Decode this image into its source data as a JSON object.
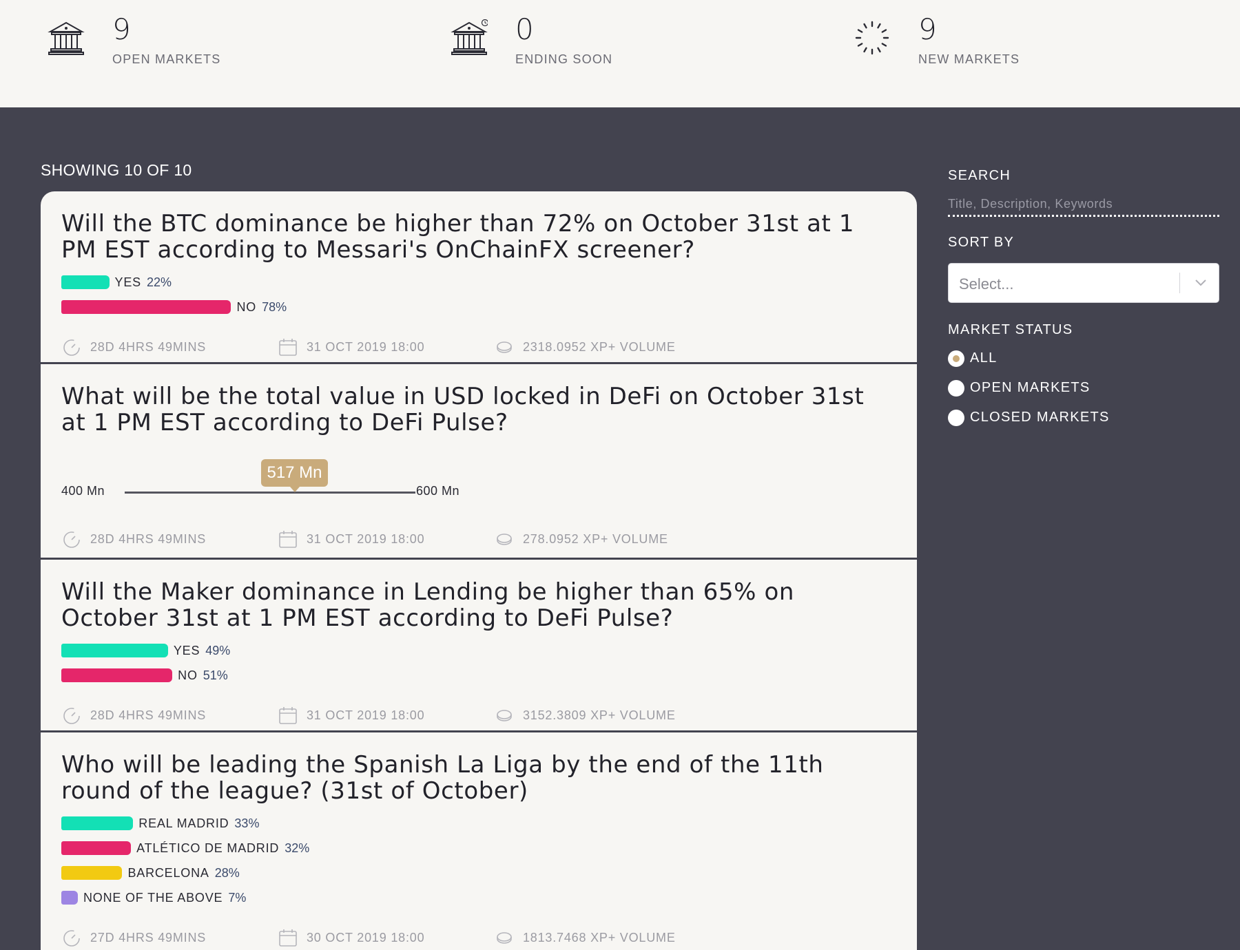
{
  "stats": [
    {
      "value": "9",
      "label": "OPEN MARKETS",
      "icon": "bank-icon"
    },
    {
      "value": "0",
      "label": "ENDING SOON",
      "icon": "bank-clock-icon"
    },
    {
      "value": "9",
      "label": "NEW MARKETS",
      "icon": "loading-spinner-icon"
    }
  ],
  "list": {
    "showing": "SHOWING 10 OF 10"
  },
  "markets": [
    {
      "type": "binary",
      "title": "Will the BTC dominance be higher than 72% on October 31st at 1 PM EST according to Messari's OnChainFX screener?",
      "outcomes": [
        {
          "name": "YES",
          "pct": "22%",
          "share": 22,
          "color": "#13e0b5"
        },
        {
          "name": "NO",
          "pct": "78%",
          "share": 78,
          "color": "#e5266a"
        }
      ],
      "time_left": "28D 4HRS 49MINS",
      "end_date": "31 OCT 2019 18:00",
      "volume": "2318.0952 XP+ VOLUME"
    },
    {
      "type": "scalar",
      "title": "What will be the total value in USD locked in DeFi on October 31st at 1 PM EST according to DeFi Pulse?",
      "scalar": {
        "min": "400 Mn",
        "max": "600 Mn",
        "value": "517 Mn"
      },
      "time_left": "28D 4HRS 49MINS",
      "end_date": "31 OCT 2019 18:00",
      "volume": "278.0952 XP+ VOLUME"
    },
    {
      "type": "binary",
      "title": "Will the Maker dominance in Lending be higher than 65% on October 31st at 1 PM EST according to DeFi Pulse?",
      "outcomes": [
        {
          "name": "YES",
          "pct": "49%",
          "share": 49,
          "color": "#13e0b5"
        },
        {
          "name": "NO",
          "pct": "51%",
          "share": 51,
          "color": "#e5266a"
        }
      ],
      "time_left": "28D 4HRS 49MINS",
      "end_date": "31 OCT 2019 18:00",
      "volume": "3152.3809 XP+ VOLUME"
    },
    {
      "type": "categorical",
      "title": "Who will be leading the Spanish La Liga by the end of the 11th round of the league? (31st of October)",
      "outcomes": [
        {
          "name": "REAL MADRID",
          "pct": "33%",
          "share": 33,
          "color": "#13e0b5"
        },
        {
          "name": "ATLÉTICO DE MADRID",
          "pct": "32%",
          "share": 32,
          "color": "#e5266a"
        },
        {
          "name": "BARCELONA",
          "pct": "28%",
          "share": 28,
          "color": "#f2ca12"
        },
        {
          "name": "NONE OF THE ABOVE",
          "pct": "7%",
          "share": 7,
          "color": "#9d85e3"
        }
      ],
      "time_left": "27D 4HRS 49MINS",
      "end_date": "30 OCT 2019 18:00",
      "volume": "1813.7468 XP+ VOLUME"
    }
  ],
  "filters": {
    "search_label": "SEARCH",
    "search_placeholder": "Title, Description, Keywords",
    "sort_label": "SORT BY",
    "sort_value": "Select...",
    "status_label": "MARKET STATUS",
    "status_options": [
      {
        "label": "ALL",
        "checked": true
      },
      {
        "label": "OPEN MARKETS",
        "checked": false
      },
      {
        "label": "CLOSED MARKETS",
        "checked": false
      }
    ]
  },
  "colors": {
    "accent": "#c9ab7b",
    "background": "#43434f",
    "card": "#f7f6f3"
  }
}
